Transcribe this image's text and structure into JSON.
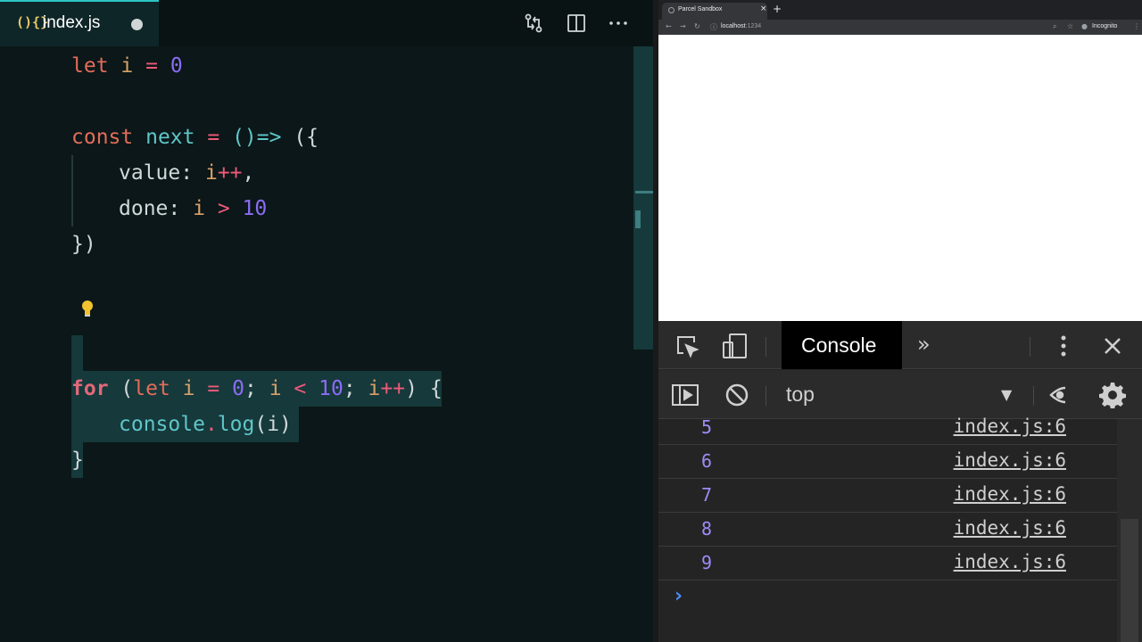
{
  "editor": {
    "tab": {
      "icon": "(){}",
      "filename": "index.js"
    },
    "code": {
      "line1": {
        "kw": "let",
        "var": "i",
        "op": "=",
        "num": "0"
      },
      "line3": {
        "kw": "const",
        "fn": "next",
        "op": "=",
        "arrow": "()=>",
        "rest": "({"
      },
      "line4": {
        "key": "value:",
        "var": "i",
        "op": "++",
        "punc": ","
      },
      "line5": {
        "key": "done:",
        "var": "i",
        "op": ">",
        "num": "10"
      },
      "line6": "})",
      "line8": {
        "kw": "for",
        "p1": "(",
        "kw2": "let",
        "var": "i",
        "op": "=",
        "num": "0",
        "semi": ";",
        "var2": "i",
        "op2": "<",
        "num2": "10",
        "semi2": ";",
        "var3": "i",
        "op3": "++",
        "p2": ")",
        "brace": "{"
      },
      "line9": {
        "fn": "console",
        "dot": ".",
        "method": "log",
        "arg": "(i)"
      },
      "line10": "}"
    }
  },
  "browser": {
    "tab_title": "Parcel Sandbox",
    "tab_close": "×",
    "new_tab": "+",
    "url_host": "localhost",
    "url_port": ":1234",
    "incognito_label": "Incognito",
    "devtools": {
      "console_tab": "Console",
      "more_tabs": "»",
      "context": "top",
      "context_arrow": "▼",
      "logs": [
        {
          "value": "5",
          "source": "index.js:6"
        },
        {
          "value": "6",
          "source": "index.js:6"
        },
        {
          "value": "7",
          "source": "index.js:6"
        },
        {
          "value": "8",
          "source": "index.js:6"
        },
        {
          "value": "9",
          "source": "index.js:6"
        }
      ],
      "prompt": "›"
    }
  }
}
